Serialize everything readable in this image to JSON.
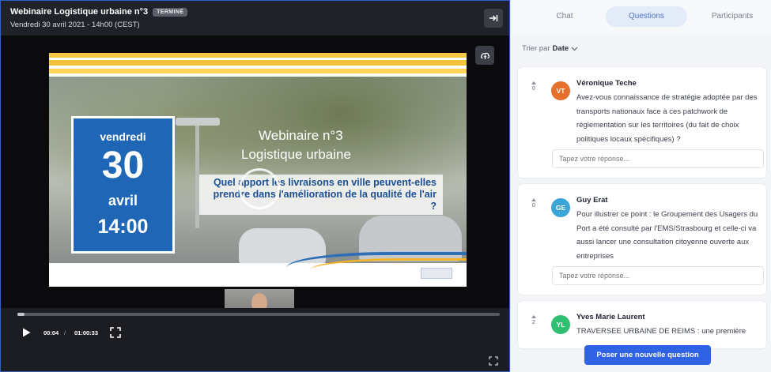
{
  "webinar": {
    "title": "Webinaire Logistique urbaine n°3",
    "status": "TERMINÉ",
    "date": "Vendredi 30 avril 2021 - 14h00 (CEST)"
  },
  "slide": {
    "day": "vendredi",
    "date_num": "30",
    "month": "avril",
    "time": "14:00",
    "title_line1": "Webinaire n°3",
    "title_line2": "Logistique urbaine",
    "question": "Quel apport les livraisons en ville peuvent-elles prendre dans l'amélioration de la qualité de l'air ?"
  },
  "player": {
    "current_time": "00:04",
    "separator": "/",
    "total_time": "01:00:33",
    "progress_fraction": 0.002
  },
  "panel": {
    "tabs": [
      "Chat",
      "Questions",
      "Participants"
    ],
    "active_tab": "Questions",
    "sort_label": "Trier par",
    "sort_value": "Date",
    "reply_placeholder": "Tapez votre réponse...",
    "questions": [
      {
        "initials": "VT",
        "author": "Véronique Teche",
        "votes": "0",
        "text": "Avez-vous connaissance de stratégie adoptée par des transports nationaux face à ces patchwork de réglementation sur les territoires (du fait de choix politiques locaux spécifiques) ?",
        "avatar_color": "#e56f2b"
      },
      {
        "initials": "GE",
        "author": "Guy Erat",
        "votes": "0",
        "text": "Pour illustrer ce point : le Groupement des Usagers du Port a été consulté par l'EMS/Strasbourg et celle-ci va aussi lancer une consultation citoyenne ouverte aux entreprises",
        "avatar_color": "#3aa6d8"
      },
      {
        "initials": "YL",
        "author": "Yves Marie Laurent",
        "votes": "2",
        "text": "TRAVERSEE URBAINE DE REIMS : une première",
        "avatar_color": "#2fbf71"
      }
    ],
    "ask_button": "Poser une nouvelle question"
  }
}
